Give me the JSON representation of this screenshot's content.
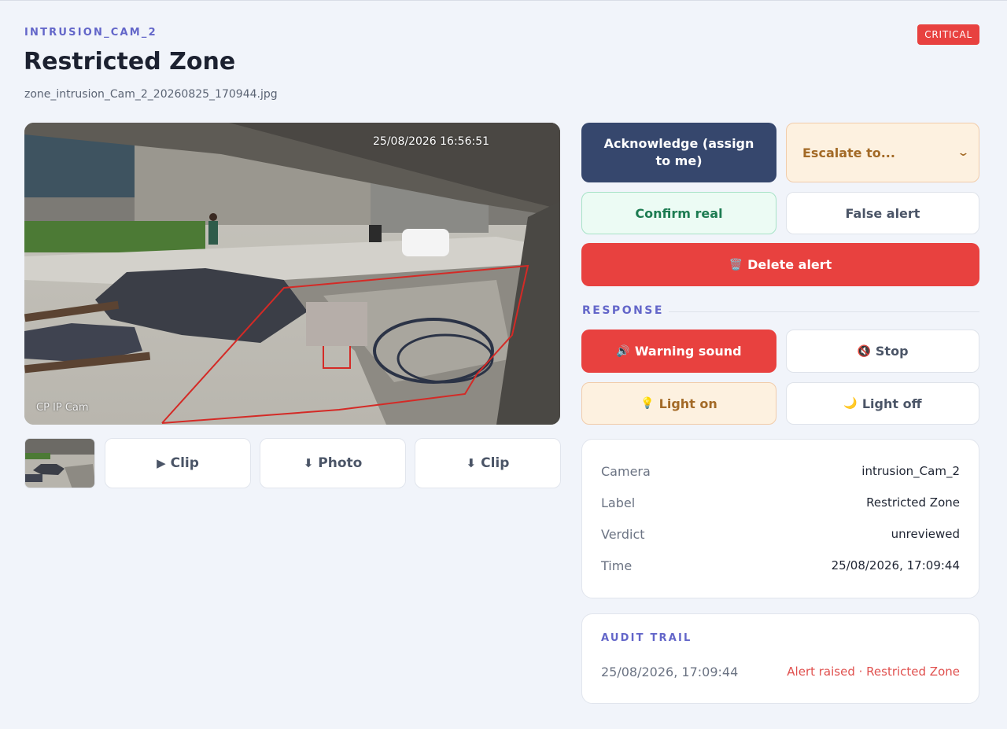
{
  "header": {
    "camera_tag": "INTRUSION_CAM_2",
    "severity": "CRITICAL",
    "title": "Restricted Zone",
    "filename": "zone_intrusion_Cam_2_20260825_170944.jpg"
  },
  "snapshot": {
    "overlay_timestamp": "25/08/2026 16:56:51",
    "overlay_camera": "CP IP Cam"
  },
  "media_actions": [
    {
      "icon": "play-icon",
      "glyph": "▶",
      "label": "Clip"
    },
    {
      "icon": "download-icon",
      "glyph": "⬇",
      "label": "Photo"
    },
    {
      "icon": "download-icon",
      "glyph": "⬇",
      "label": "Clip"
    }
  ],
  "actions": {
    "acknowledge": "Acknowledge (assign to me)",
    "escalate": "Escalate to...",
    "escalate_chevron": "⌄",
    "confirm": "Confirm real",
    "false_alert": "False alert",
    "delete": "Delete alert",
    "delete_icon": "🗑️"
  },
  "response": {
    "label": "RESPONSE",
    "warning_sound": "Warning sound",
    "warning_icon": "🔊",
    "stop": "Stop",
    "stop_icon": "🔇",
    "light_on": "Light on",
    "light_on_icon": "💡",
    "light_off": "Light off",
    "light_off_icon": "🌙"
  },
  "details": [
    {
      "key": "Camera",
      "value": "intrusion_Cam_2"
    },
    {
      "key": "Label",
      "value": "Restricted Zone"
    },
    {
      "key": "Verdict",
      "value": "unreviewed"
    },
    {
      "key": "Time",
      "value": "25/08/2026, 17:09:44"
    }
  ],
  "audit": {
    "label": "AUDIT TRAIL",
    "entries": [
      {
        "time": "25/08/2026, 17:09:44",
        "event": "Alert raised · Restricted Zone"
      }
    ]
  },
  "colors": {
    "accent": "#6366c9",
    "critical": "#e8413f",
    "primary": "#36476d",
    "success": "#1d7c52",
    "warning": "#a36a27"
  }
}
